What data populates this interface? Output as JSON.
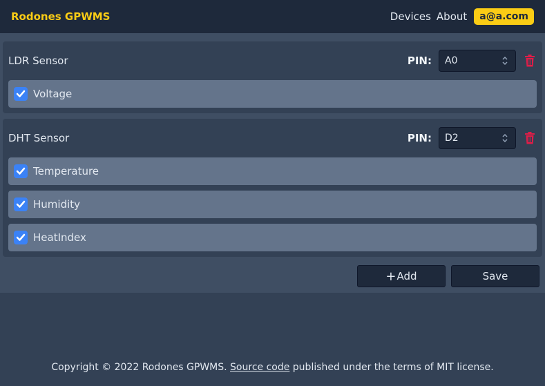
{
  "navbar": {
    "brand": "Rodones GPWMS",
    "links": [
      "Devices",
      "About"
    ],
    "user": "a@a.com"
  },
  "sensors": [
    {
      "name": "LDR Sensor",
      "pin_label": "PIN:",
      "pin_value": "A0",
      "measurements": [
        {
          "label": "Voltage",
          "checked": true
        }
      ]
    },
    {
      "name": "DHT Sensor",
      "pin_label": "PIN:",
      "pin_value": "D2",
      "measurements": [
        {
          "label": "Temperature",
          "checked": true
        },
        {
          "label": "Humidity",
          "checked": true
        },
        {
          "label": "HeatIndex",
          "checked": true
        }
      ]
    }
  ],
  "actions": {
    "add_icon": "+",
    "add_label": "Add",
    "save_label": "Save"
  },
  "footer": {
    "prefix": "Copyright © 2022 Rodones GPWMS. ",
    "link": "Source code",
    "suffix": " published under the terms of MIT license."
  },
  "colors": {
    "accent": "#facc15",
    "checkbox": "#3b82f6",
    "delete": "#e11d48"
  }
}
